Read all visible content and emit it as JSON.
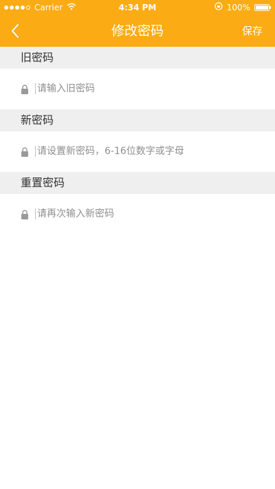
{
  "status_bar": {
    "carrier": "Carrier",
    "time": "4:34 PM",
    "battery": "100%"
  },
  "nav": {
    "title": "修改密码",
    "save_label": "保存"
  },
  "sections": [
    {
      "header": "旧密码",
      "placeholder": "请输入旧密码"
    },
    {
      "header": "新密码",
      "placeholder": "请设置新密码，6-16位数字或字母"
    },
    {
      "header": "重置密码",
      "placeholder": "请再次输入新密码"
    }
  ],
  "colors": {
    "accent": "#fbab14",
    "section_bg": "#efefef",
    "placeholder": "#8e8e8e"
  }
}
